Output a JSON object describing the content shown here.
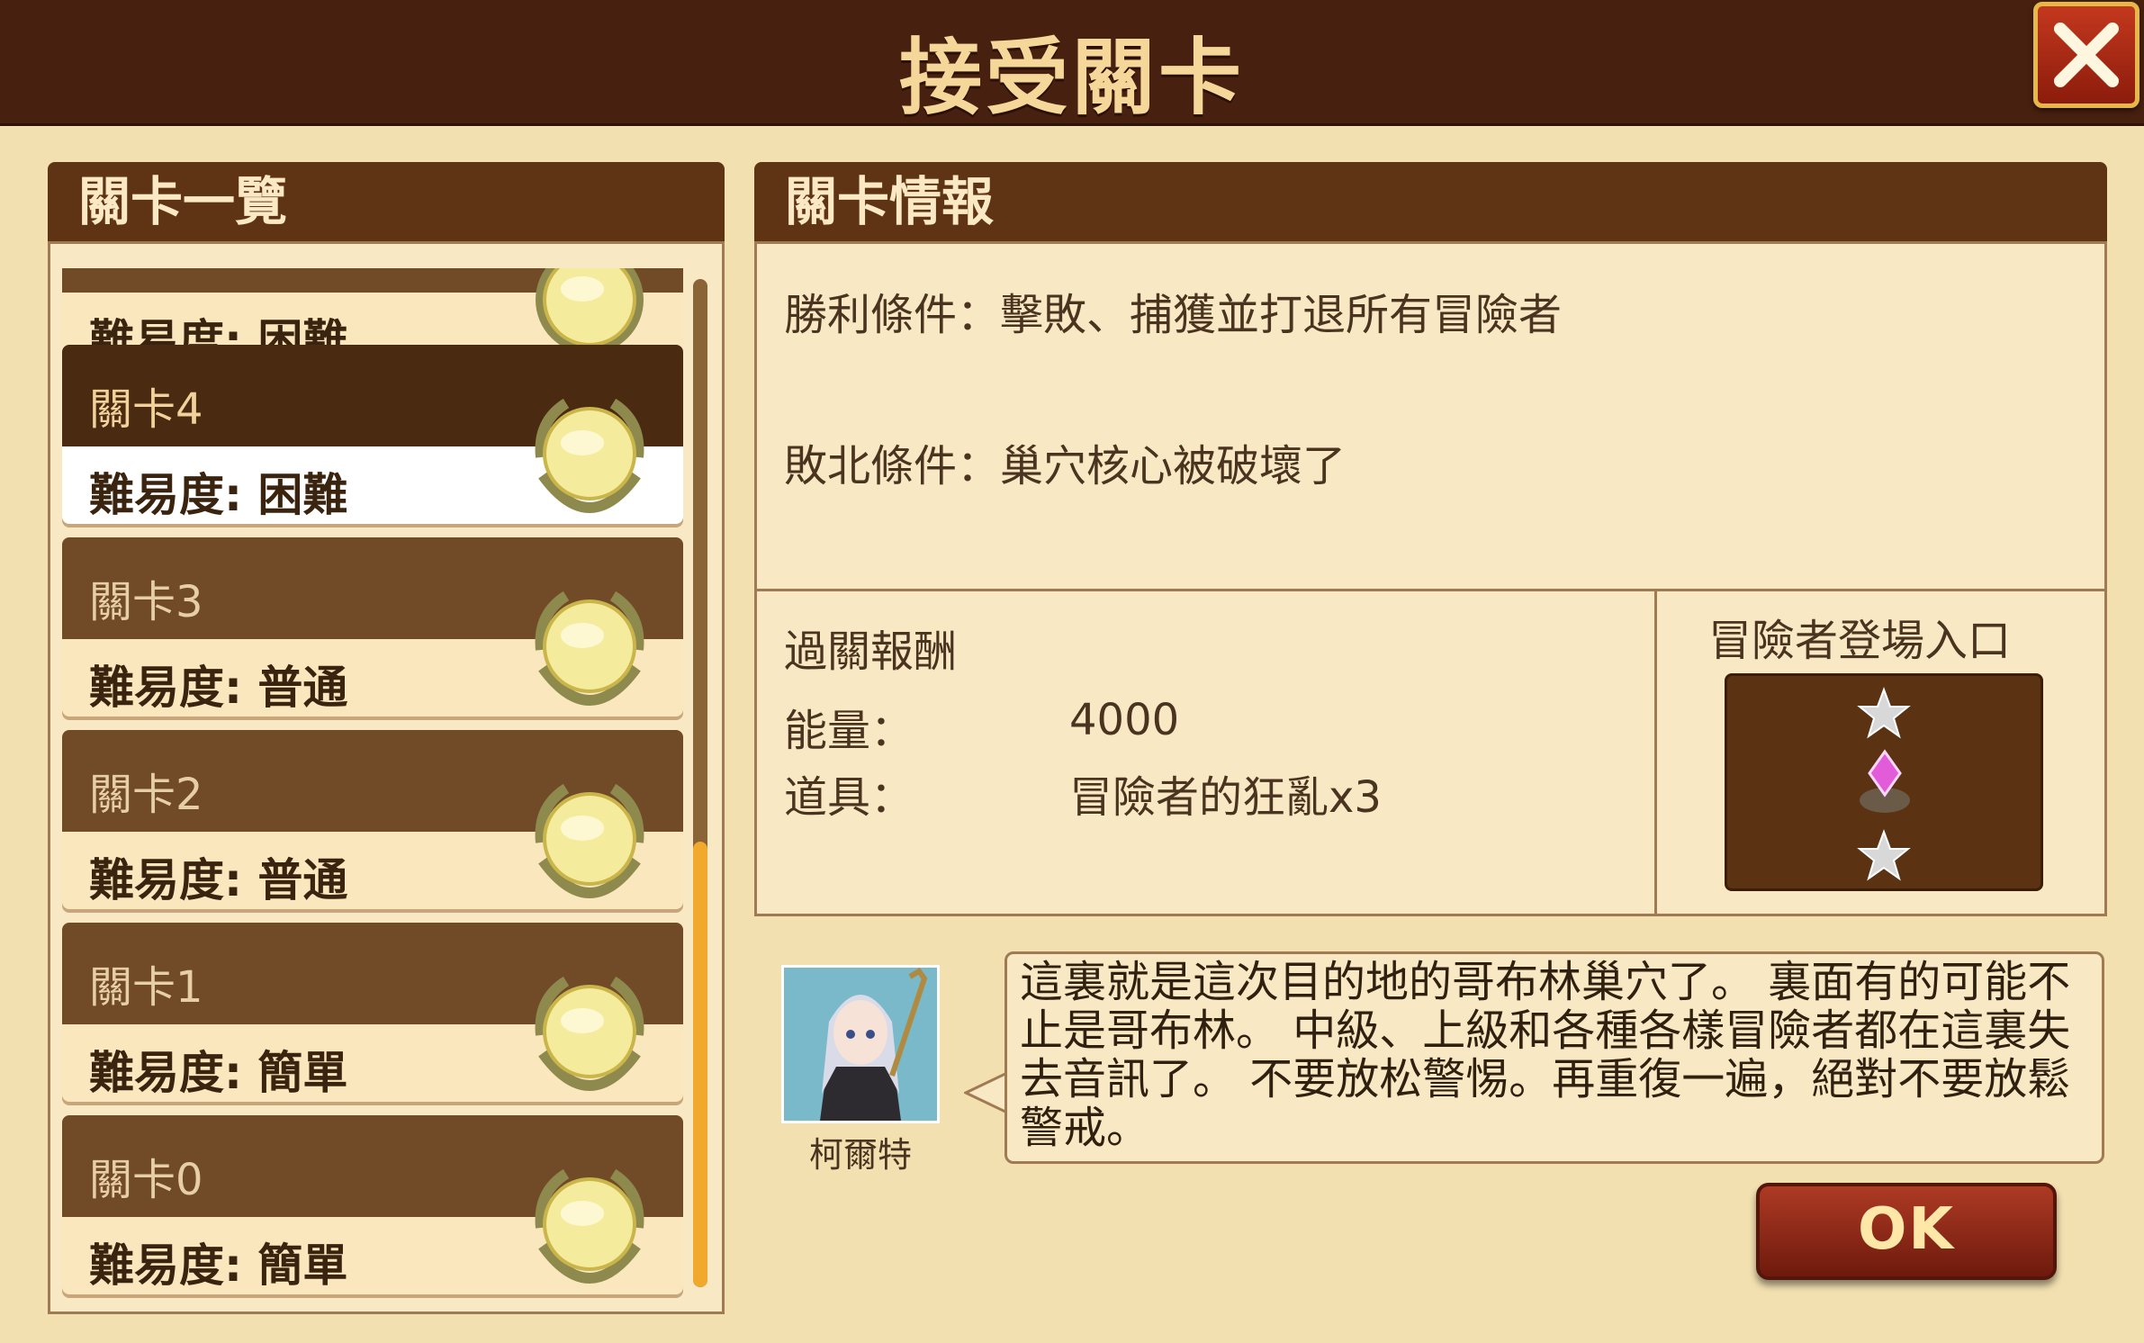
{
  "header": {
    "title": "接受關卡"
  },
  "stage_list": {
    "heading": "關卡一覽",
    "items": [
      {
        "name": "",
        "difficulty": "難易度: 困難"
      },
      {
        "name": "關卡4",
        "difficulty": "難易度: 困難",
        "selected": true
      },
      {
        "name": "關卡3",
        "difficulty": "難易度: 普通"
      },
      {
        "name": "關卡2",
        "difficulty": "難易度: 普通"
      },
      {
        "name": "關卡1",
        "difficulty": "難易度: 簡單"
      },
      {
        "name": "關卡0",
        "difficulty": "難易度: 簡單"
      }
    ]
  },
  "stage_info": {
    "heading": "關卡情報",
    "win_condition": "勝利條件：擊敗、捕獲並打退所有冒險者",
    "lose_condition": "敗北條件：巢穴核心被破壞了",
    "rewards": {
      "heading": "過關報酬",
      "energy_label": "能量：",
      "energy_value": "4000",
      "item_label": "道具：",
      "item_value": "冒險者的狂亂x3"
    },
    "spawn": {
      "heading": "冒險者登場入口"
    }
  },
  "dialogue": {
    "speaker": "柯爾特",
    "text": "這裏就是這次目的地的哥布林巢穴了。 裏面有的可能不止是哥布林。 中級、上級和各種各樣冒險者都在這裏失去音訊了。 不要放松警惕。再重復一遍，絕對不要放鬆警戒。"
  },
  "actions": {
    "ok_label": "OK"
  },
  "colors": {
    "header_bg": "#47200f",
    "title_text": "#f6d79a",
    "panel_header": "#5e3414",
    "accent": "#f0a92c",
    "ok_button": "#8c2414"
  }
}
